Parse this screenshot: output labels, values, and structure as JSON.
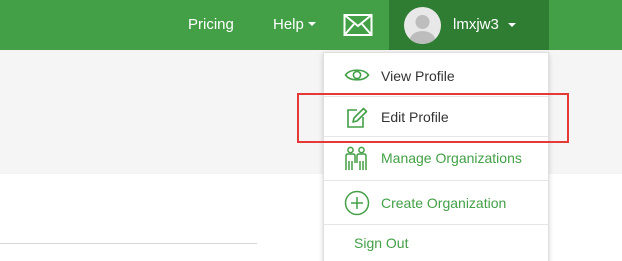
{
  "header": {
    "nav": {
      "pricing": "Pricing",
      "help": "Help"
    },
    "user": {
      "username": "lmxjw3"
    }
  },
  "dropdown": {
    "items": [
      {
        "label": "View Profile",
        "icon": "eye-icon"
      },
      {
        "label": "Edit Profile",
        "icon": "edit-icon"
      },
      {
        "label": "Manage Organizations",
        "icon": "people-icon"
      },
      {
        "label": "Create Organization",
        "icon": "plus-circle-icon"
      },
      {
        "label": "Sign Out"
      }
    ]
  },
  "colors": {
    "header_green": "#43a047",
    "user_menu_green": "#2e7d32",
    "link_green": "#43a047",
    "highlight_red": "#e53935"
  }
}
